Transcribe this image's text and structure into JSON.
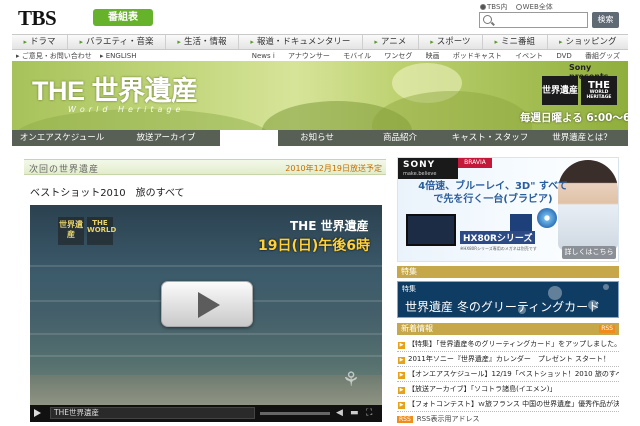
{
  "header": {
    "logo": "TBS",
    "program_guide_button": "番組表",
    "search_scope": [
      "TBS内",
      "WEB全体"
    ],
    "search_placeholder": "",
    "search_button": "検索"
  },
  "nav_primary": [
    "ドラマ",
    "バラエティ・音楽",
    "生活・情報",
    "報道・ドキュメンタリー",
    "アニメ",
    "スポーツ",
    "ミニ番組",
    "ショッピング"
  ],
  "nav_secondary_left": [
    "ご意見・お問い合わせ",
    "ENGLISH"
  ],
  "nav_secondary_right": [
    "News i",
    "アナウンサー",
    "モバイル",
    "ワンセグ",
    "映画",
    "ポッドキャスト",
    "イベント",
    "DVD",
    "番組グッズ"
  ],
  "banner": {
    "title": "THE 世界遺産",
    "subtitle": "World Heritage",
    "sponsor": "Sony presents",
    "logo_left": "世界遺産",
    "logo_right_main": "THE",
    "logo_right_sub": "WORLD HERITAGE",
    "airtime": "毎週日曜よる 6:00～6:30"
  },
  "tabs": [
    "オンエアスケジュール",
    "放送アーカイブ",
    "",
    "お知らせ",
    "商品紹介",
    "キャスト・スタッフ",
    "世界遺産とは？"
  ],
  "next": {
    "label": "次回の世界遺産",
    "date": "2010年12月19日放送予定",
    "title": "ベストショット2010　旅のすべて"
  },
  "video": {
    "logo_left": "世界遺産",
    "logo_right": "THE WORLD",
    "show": "THE 世界遺産",
    "time": "19日(日)午後6時",
    "caption": "THE世界遺産"
  },
  "ad": {
    "brand": "SONY",
    "tagline": "make.believe",
    "product": "BRAVIA",
    "headline": "4倍速、ブルーレイ、3D\" すべてで先を行く一台(ブラビア)",
    "series": "HX80Rシリーズ",
    "detail": "詳しくはこちら",
    "fine": "※HX80Rシリーズ専用のメガネは別売です"
  },
  "special": {
    "head": "特集",
    "banner_tag": "特集",
    "banner_text": "世界遺産 冬のグリーティングカード"
  },
  "news": {
    "head": "新着情報",
    "rss": "RSS",
    "items": [
      "【特集】「世界遺産冬のグリーティングカード」をアップしました。",
      "2011年ソニー『世界遺産』カレンダー　プレゼント スタート！",
      "【オンエアスケジュール】12/19「ベストショット！2010 旅のすべ...",
      "【放送アーカイブ】「ソコトラ諸島(イエメン)」",
      "【フォトコンテスト】ｗ旅フランス 中国の世界遺産」優秀作品が決定！"
    ]
  },
  "rss_row": {
    "tag": "RSS",
    "label": "RSS表示用アドレス"
  }
}
